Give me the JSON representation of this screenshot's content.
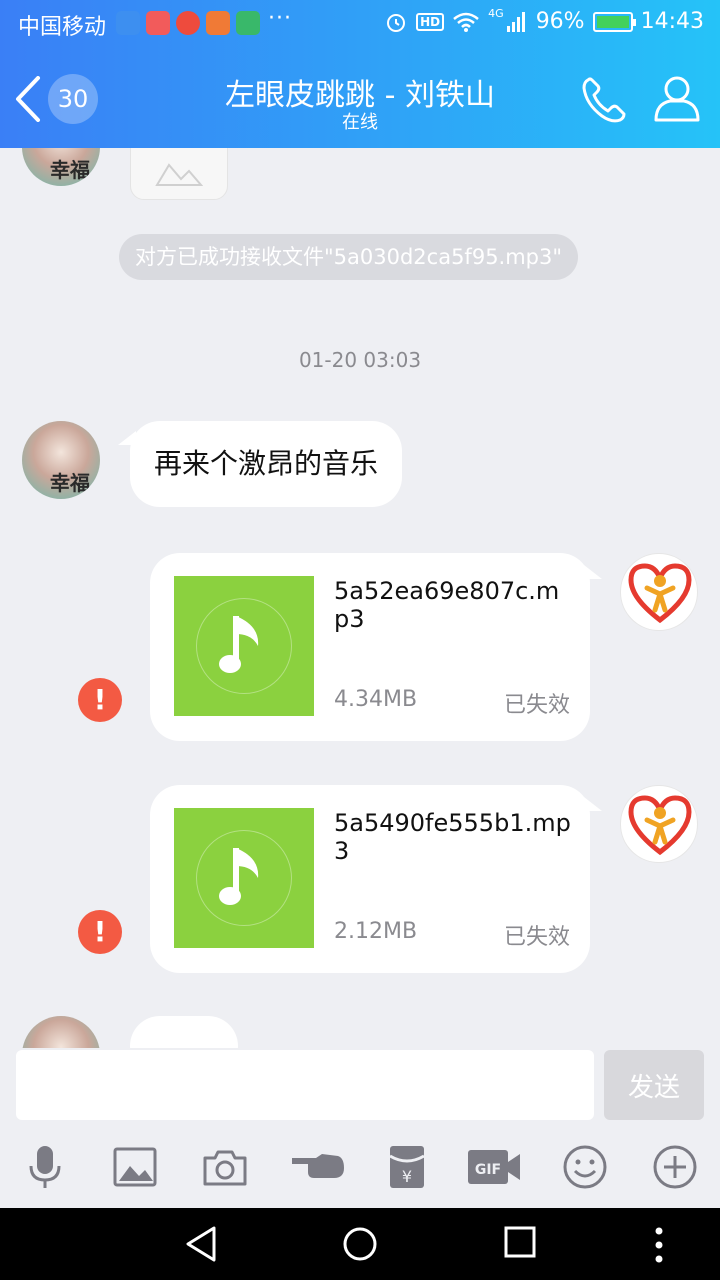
{
  "status_bar": {
    "carrier": "中国移动",
    "more": "···",
    "hd": "HD",
    "network": "4G",
    "battery": "96%",
    "time": "14:43"
  },
  "header": {
    "unread_count": "30",
    "title": "左眼皮跳跳 - 刘铁山",
    "subtitle": "在线"
  },
  "chat": {
    "avatar_left_text": "幸福",
    "system_notice": "对方已成功接收文件\"5a030d2ca5f95.mp3\"",
    "timestamp": "01-20 03:03",
    "message_text": "再来个激昂的音乐",
    "files": [
      {
        "name": "5a52ea69e807c.mp3",
        "size": "4.34MB",
        "status": "已失效"
      },
      {
        "name": "5a5490fe555b1.mp3",
        "size": "2.12MB",
        "status": "已失效"
      }
    ],
    "error_mark": "!"
  },
  "input": {
    "placeholder": "",
    "send_label": "发送"
  },
  "colors": {
    "header_start": "#3a7ff6",
    "header_end": "#25c3f8",
    "music_green": "#8bd13f",
    "error_red": "#f35a43"
  }
}
